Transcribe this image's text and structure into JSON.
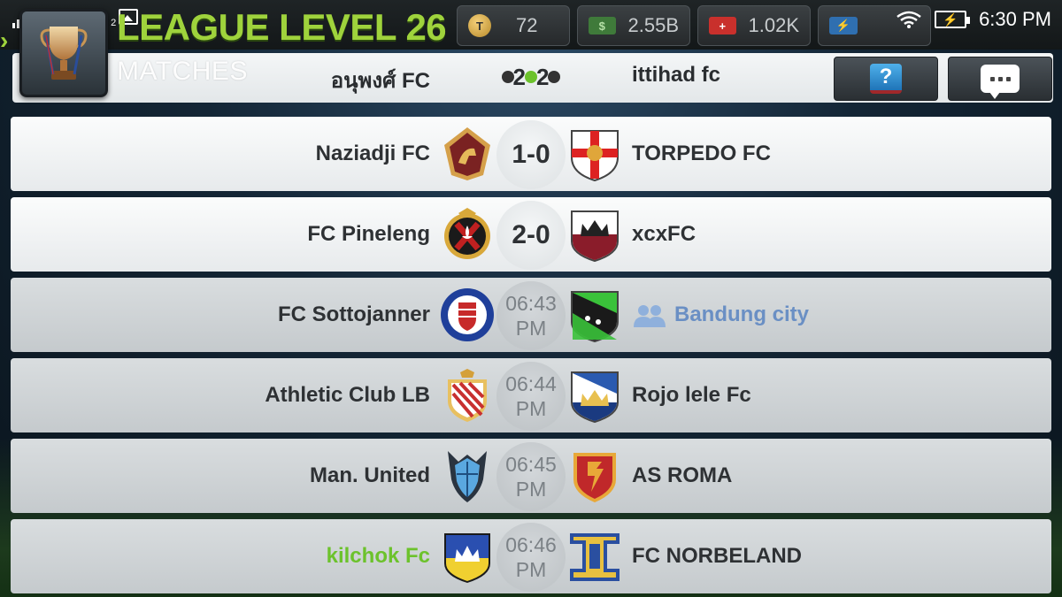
{
  "status_bar": {
    "signal1_num": "1",
    "signal2_num": "2",
    "time": "6:30 PM"
  },
  "header": {
    "title": "LEAGUE LEVEL 26",
    "subtitle": "MATCHES"
  },
  "resources": [
    {
      "icon": "token-coin-icon",
      "icon_glyph": "T",
      "value": "72"
    },
    {
      "icon": "cash-icon",
      "icon_glyph": "$",
      "value": "2.55B"
    },
    {
      "icon": "medical-icon",
      "icon_glyph": "+",
      "value": "1.02K"
    },
    {
      "icon": "energy-icon",
      "icon_glyph": "⚡",
      "value": ""
    }
  ],
  "current_match": {
    "home": "อนุพงศ์ FC",
    "away": "ittihad fc",
    "score_glyph": "2"
  },
  "matches": [
    {
      "home": "Naziadji FC",
      "away": "TORPEDO FC",
      "result": "1-0",
      "time": "",
      "ampm": "",
      "status": "played"
    },
    {
      "home": "FC Pineleng",
      "away": "xcxFC",
      "result": "2-0",
      "time": "",
      "ampm": "",
      "status": "played"
    },
    {
      "home": "FC Sottojanner",
      "away": "Bandung city",
      "result": "",
      "time": "06:43",
      "ampm": "PM",
      "status": "upcoming"
    },
    {
      "home": "Athletic Club LB",
      "away": "Rojo lele Fc",
      "result": "",
      "time": "06:44",
      "ampm": "PM",
      "status": "upcoming"
    },
    {
      "home": "Man. United",
      "away": "AS ROMA",
      "result": "",
      "time": "06:45",
      "ampm": "PM",
      "status": "upcoming"
    },
    {
      "home": "kilchok Fc",
      "away": "FC NORBELAND",
      "result": "",
      "time": "06:46",
      "ampm": "PM",
      "status": "upcoming"
    }
  ],
  "colors": {
    "accent_green": "#9fd33c",
    "user_green": "#6cc22c",
    "friend_blue": "#6a8fc4"
  }
}
